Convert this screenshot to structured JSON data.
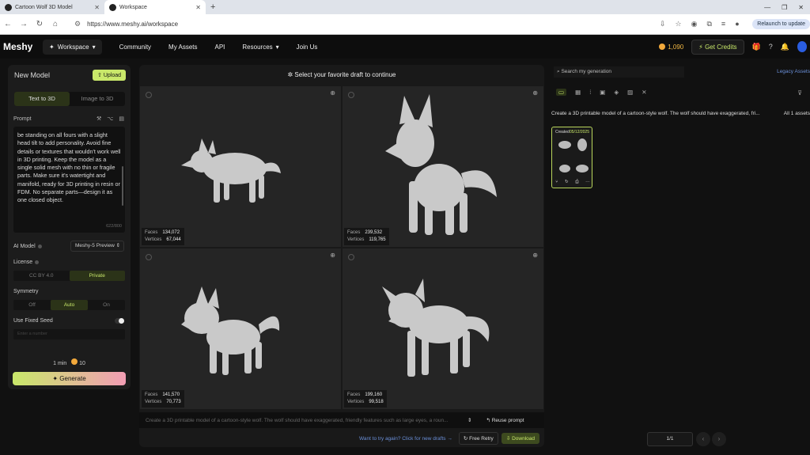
{
  "browser": {
    "tabs": [
      {
        "label": "Cartoon Wolf 3D Model"
      },
      {
        "label": "Workspace"
      }
    ],
    "url": "https://www.meshy.ai/workspace",
    "relaunch_label": "Relaunch to update"
  },
  "header": {
    "logo": "Meshy",
    "nav": {
      "workspace": "Workspace",
      "community": "Community",
      "my_assets": "My Assets",
      "api": "API",
      "resources": "Resources",
      "join_us": "Join Us"
    },
    "credits": "1,090",
    "get_credits": "Get Credits"
  },
  "left": {
    "title": "New Model",
    "upload": "Upload",
    "tabs": {
      "text_to_3d": "Text to 3D",
      "image_to_3d": "Image to 3D"
    },
    "prompt_label": "Prompt",
    "prompt_text": "be standing on all fours with a slight head tilt to add personality. Avoid fine details or textures that wouldn't work well in 3D printing. Keep the model as a single solid mesh with no thin or fragile parts. Make sure it's watertight and manifold, ready for 3D printing in resin or FDM. No separate parts—design it as one closed object.",
    "prompt_count": "622/800",
    "ai_model_label": "AI Model",
    "ai_model_value": "Meshy-5 Preview",
    "license_label": "License",
    "license_options": {
      "cc": "CC BY 4.0",
      "private": "Private"
    },
    "symmetry_label": "Symmetry",
    "symmetry_options": {
      "off": "Off",
      "auto": "Auto",
      "on": "On"
    },
    "fixed_seed_label": "Use Fixed Seed",
    "seed_placeholder": "Enter a number",
    "cost_time": "1 min",
    "cost_credits": "10",
    "generate": "Generate"
  },
  "center": {
    "heading": "Select your favorite draft to continue",
    "faces_label": "Faces",
    "vertices_label": "Vertices",
    "drafts": [
      {
        "faces": "134,072",
        "vertices": "67,044"
      },
      {
        "faces": "239,532",
        "vertices": "119,765"
      },
      {
        "faces": "141,570",
        "vertices": "70,773"
      },
      {
        "faces": "199,160",
        "vertices": "99,518"
      }
    ],
    "prompt_preview": "Create a 3D printable model of a cartoon-style wolf. The wolf should have exaggerated, friendly features such as large eyes, a roun...",
    "reuse_prompt": "Reuse prompt",
    "try_again": "Want to try again? Click for new drafts →",
    "free_retry": "Free Retry",
    "download": "Download"
  },
  "right": {
    "search_placeholder": "Search my generation",
    "legacy_assets": "Legacy Assets",
    "generation_prompt": "Create a 3D printable model of a cartoon-style wolf. The wolf should have exaggerated, fri...",
    "all_assets": "All 1 assets",
    "card_created": "Created",
    "card_date": "05/12/2025",
    "pager": "1/1"
  },
  "colors": {
    "accent": "#c9e86a",
    "link": "#6a8fd8",
    "coin": "#f2a93b"
  }
}
